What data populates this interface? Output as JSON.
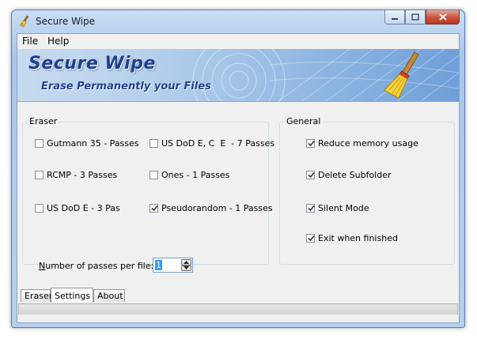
{
  "window": {
    "title": "Secure Wipe",
    "icon": "broom-icon",
    "controls": [
      "minimize-icon",
      "maximize-icon",
      "close-icon"
    ]
  },
  "menu": {
    "file": "File",
    "help": "Help"
  },
  "banner": {
    "title": "Secure Wipe",
    "subtitle": "Erase Permanently your Files",
    "icon": "broom-icon"
  },
  "eraser": {
    "label": "Eraser",
    "options": [
      {
        "label": "Gutmann 35 - Passes",
        "checked": false
      },
      {
        "label": "US DoD E, C  E  - 7 Passes",
        "checked": false
      },
      {
        "label": "RCMP - 3 Passes",
        "checked": false
      },
      {
        "label": "Ones - 1 Passes",
        "checked": false
      },
      {
        "label": "US DoD E - 3 Pas",
        "checked": false
      },
      {
        "label": "Pseudorandom - 1 Passes",
        "checked": true
      }
    ],
    "passes_label_prefix": "N",
    "passes_label_rest": "umber of passes per file:",
    "passes_value": "1"
  },
  "general": {
    "label": "General",
    "options": [
      {
        "label": "Reduce memory usage",
        "checked": true
      },
      {
        "label": "Delete Subfolder",
        "checked": true
      },
      {
        "label": "Silent Mode",
        "checked": true
      },
      {
        "label": "Exit when finished",
        "checked": true
      }
    ]
  },
  "tabs": [
    {
      "label": "Eraser",
      "active": false
    },
    {
      "label": "Settings",
      "active": true
    },
    {
      "label": "About",
      "active": false
    }
  ],
  "colors": {
    "banner_text": "#1e3f8f",
    "title_blue": "#a9c6ea",
    "close_red": "#c9513a"
  }
}
